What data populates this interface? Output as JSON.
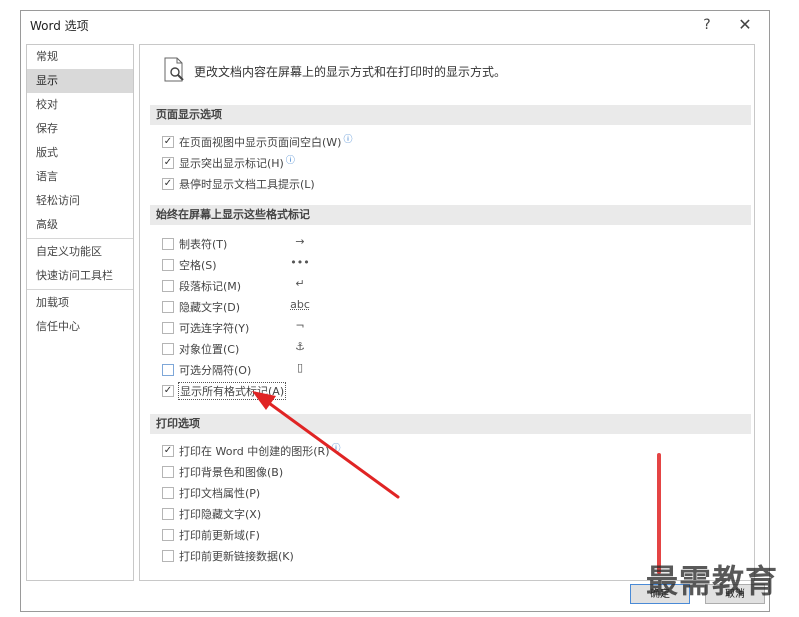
{
  "window": {
    "title": "Word 选项",
    "help": "?",
    "close": "✕"
  },
  "sidebar": {
    "groups": [
      [
        "常规",
        "显示",
        "校对",
        "保存",
        "版式",
        "语言",
        "轻松访问",
        "高级"
      ],
      [
        "自定义功能区",
        "快速访问工具栏"
      ],
      [
        "加载项",
        "信任中心"
      ]
    ],
    "active": "显示"
  },
  "header": {
    "text": "更改文档内容在屏幕上的显示方式和在打印时的显示方式。"
  },
  "sections": {
    "page_display": {
      "title": "页面显示选项",
      "items": [
        {
          "label": "在页面视图中显示页面间空白(W)",
          "checked": true,
          "info": true
        },
        {
          "label": "显示突出显示标记(H)",
          "checked": true,
          "info": true
        },
        {
          "label": "悬停时显示文档工具提示(L)",
          "checked": true,
          "info": false
        }
      ]
    },
    "format_marks": {
      "title": "始终在屏幕上显示这些格式标记",
      "items": [
        {
          "label": "制表符(T)",
          "checked": false,
          "mark": "→"
        },
        {
          "label": "空格(S)",
          "checked": false,
          "mark": "•••"
        },
        {
          "label": "段落标记(M)",
          "checked": false,
          "mark": "↵"
        },
        {
          "label": "隐藏文字(D)",
          "checked": false,
          "mark": "abc"
        },
        {
          "label": "可选连字符(Y)",
          "checked": false,
          "mark": "¬"
        },
        {
          "label": "对象位置(C)",
          "checked": false,
          "mark": "⚓"
        },
        {
          "label": "可选分隔符(O)",
          "checked": false,
          "mark": "▯"
        },
        {
          "label": "显示所有格式标记(A)",
          "checked": true,
          "mark": ""
        }
      ]
    },
    "print": {
      "title": "打印选项",
      "items": [
        {
          "label": "打印在 Word 中创建的图形(R)",
          "checked": true,
          "info": true
        },
        {
          "label": "打印背景色和图像(B)",
          "checked": false,
          "info": false
        },
        {
          "label": "打印文档属性(P)",
          "checked": false,
          "info": false
        },
        {
          "label": "打印隐藏文字(X)",
          "checked": false,
          "info": false
        },
        {
          "label": "打印前更新域(F)",
          "checked": false,
          "info": false
        },
        {
          "label": "打印前更新链接数据(K)",
          "checked": false,
          "info": false
        }
      ]
    }
  },
  "footer": {
    "ok": "确定",
    "cancel": "取消"
  },
  "watermark": "最需教育",
  "colors": {
    "arrow": "#e02424",
    "info": "#2a74c9",
    "section_bg": "#eaeaea",
    "active_nav": "#d9d9d9"
  }
}
